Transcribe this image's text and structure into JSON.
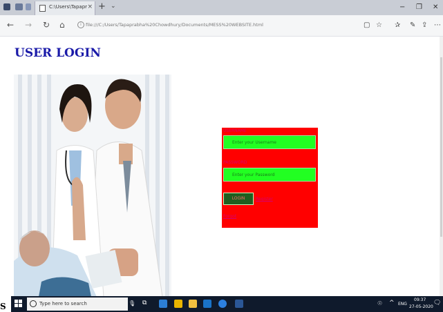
{
  "browser": {
    "tab_title": "C:\\Users\\Tapaprabha Ch",
    "tab_close": "×",
    "new_tab": "+",
    "tab_dropdown": "⌄",
    "url": "file:///C:/Users/Tapaprabha%20Chowdhury/Documents/MESS%20WEBSITE.html",
    "minimize": "−",
    "restore": "❐",
    "close": "✕"
  },
  "page": {
    "title": "USER LOGIN"
  },
  "form": {
    "username_label": "USERNAME",
    "username_placeholder": "Enter your Username",
    "password_label": "PASSWORD",
    "password_placeholder": "Enter your Password",
    "login_label": "LOGIN",
    "register_label": "Register",
    "forgot_label": "Forgot"
  },
  "taskbar": {
    "search_placeholder": "Type here to search",
    "language": "ENG",
    "time": "09:37",
    "date": "27-05-2020"
  },
  "stray_char": "S",
  "colors": {
    "title": "#1a1aa8",
    "form_bg": "#ff0000",
    "input_bg": "#22ff22",
    "label": "#d6006f",
    "button_bg": "#1f5e1f"
  },
  "icons": [
    "back-icon",
    "forward-icon",
    "refresh-icon",
    "home-icon",
    "star-icon",
    "favorites-icon",
    "pen-icon",
    "share-icon",
    "more-icon"
  ]
}
